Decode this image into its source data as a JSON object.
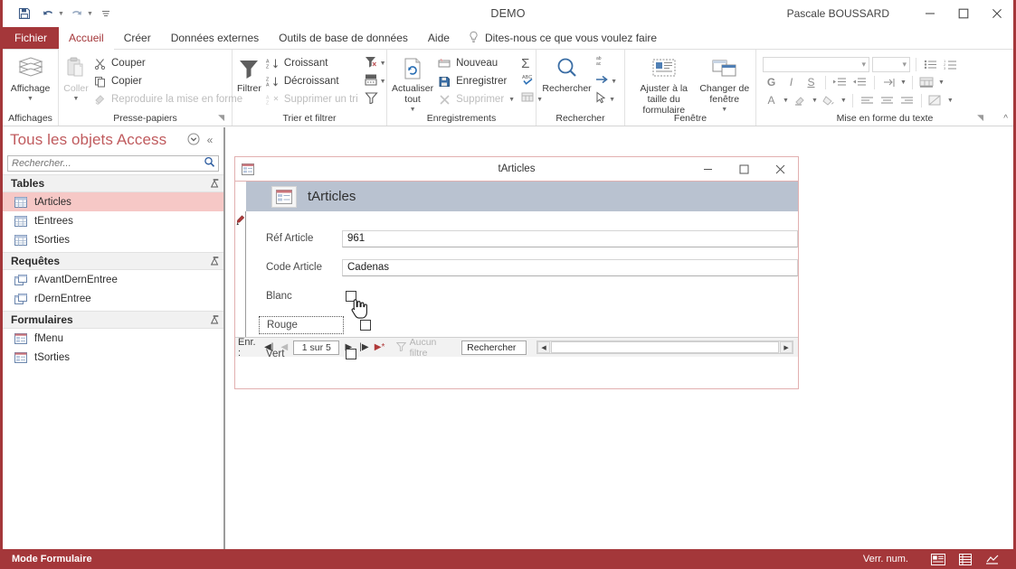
{
  "titlebar": {
    "app_title": "DEMO",
    "username": "Pascale BOUSSARD",
    "qat": [
      {
        "name": "save-icon",
        "label": "Enregistrer"
      },
      {
        "name": "undo-icon",
        "label": "Annuler"
      },
      {
        "name": "redo-icon",
        "label": "Rétablir"
      },
      {
        "name": "customize-qat-icon",
        "label": "Personnaliser la barre d'outils Accès rapide"
      }
    ],
    "window_buttons": {
      "minimize": "Réduire",
      "maximize": "Agrandir",
      "close": "Fermer"
    }
  },
  "ribbon": {
    "tabs": [
      {
        "label": "Fichier",
        "type": "file"
      },
      {
        "label": "Accueil",
        "type": "active"
      },
      {
        "label": "Créer",
        "type": "normal"
      },
      {
        "label": "Données externes",
        "type": "normal"
      },
      {
        "label": "Outils de base de données",
        "type": "normal"
      },
      {
        "label": "Aide",
        "type": "normal"
      }
    ],
    "tellme": "Dites-nous ce que vous voulez faire",
    "groups": {
      "affichages": {
        "label": "Affichages",
        "button": "Affichage"
      },
      "presse_papiers": {
        "label": "Presse-papiers",
        "paste": "Coller",
        "cut": "Couper",
        "copy": "Copier",
        "format_painter": "Reproduire la mise en forme"
      },
      "trier_filtrer": {
        "label": "Trier et filtrer",
        "filter": "Filtrer",
        "asc": "Croissant",
        "desc": "Décroissant",
        "remove_sort": "Supprimer un tri"
      },
      "enregistrements": {
        "label": "Enregistrements",
        "refresh_all": "Actualiser tout",
        "new": "Nouveau",
        "save": "Enregistrer",
        "delete": "Supprimer"
      },
      "rechercher": {
        "label": "Rechercher",
        "find": "Rechercher"
      },
      "fenetre": {
        "label": "Fenêtre",
        "fit_form": "Ajuster à la taille du formulaire",
        "switch_window": "Changer de fenêtre"
      },
      "mise_en_forme": {
        "label": "Mise en forme du texte",
        "bold": "G",
        "italic": "I",
        "underline": "S",
        "font_color": "A"
      }
    },
    "collapse": "Réduire le ruban"
  },
  "navpane": {
    "title": "Tous les objets Access",
    "menu_icon": "chevron-circle-down-icon",
    "collapse_icon": "double-chevron-left-icon",
    "search_placeholder": "Rechercher...",
    "search_value": "",
    "groups": [
      {
        "label": "Tables",
        "items": [
          {
            "label": "tArticles",
            "icon": "table-icon",
            "selected": true
          },
          {
            "label": "tEntrees",
            "icon": "table-icon",
            "selected": false
          },
          {
            "label": "tSorties",
            "icon": "table-icon",
            "selected": false
          }
        ]
      },
      {
        "label": "Requêtes",
        "items": [
          {
            "label": "rAvantDernEntree",
            "icon": "query-icon",
            "selected": false
          },
          {
            "label": "rDernEntree",
            "icon": "query-icon",
            "selected": false
          }
        ]
      },
      {
        "label": "Formulaires",
        "items": [
          {
            "label": "fMenu",
            "icon": "form-icon",
            "selected": false
          },
          {
            "label": "tSorties",
            "icon": "form-icon",
            "selected": false
          }
        ]
      }
    ]
  },
  "form_window": {
    "title": "tArticles",
    "banner_title": "tArticles",
    "window_buttons": {
      "minimize": "Réduire",
      "maximize": "Agrandir",
      "close": "Fermer"
    },
    "record_indicator": "pencil-icon",
    "fields": [
      {
        "label": "Réf Article",
        "type": "text",
        "value": "961"
      },
      {
        "label": "Code Article",
        "type": "text",
        "value": "Cadenas"
      },
      {
        "label": "Blanc",
        "type": "checkbox",
        "checked": false,
        "selected": false
      },
      {
        "label": "Rouge",
        "type": "checkbox",
        "checked": false,
        "selected": true
      },
      {
        "label": "Vert",
        "type": "checkbox",
        "checked": false,
        "selected": false
      }
    ],
    "navigator": {
      "prefix": "Enr. :",
      "first": "Premier enregistrement",
      "prev": "Enregistrement précédent",
      "position": "1 sur 5",
      "next": "Enregistrement suivant",
      "last": "Dernier enregistrement",
      "new": "Nouvel enregistrement",
      "filter_label": "Aucun filtre",
      "search_label": "Rechercher"
    }
  },
  "statusbar": {
    "mode": "Mode Formulaire",
    "numlock": "Verr. num.",
    "views": [
      {
        "name": "form-view-icon",
        "label": "Mode Formulaire"
      },
      {
        "name": "datasheet-view-icon",
        "label": "Mode Feuille de données"
      },
      {
        "name": "design-view-icon",
        "label": "Mode Création"
      }
    ]
  },
  "colors": {
    "accent": "#a4373a",
    "nav_title": "#c05b5e",
    "selection": "#f6c8c6",
    "banner": "#b9c2d0"
  }
}
